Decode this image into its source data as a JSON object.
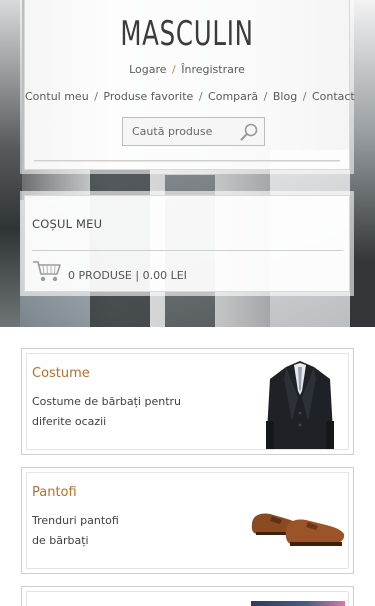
{
  "header": {
    "logo": "MASCULIN",
    "auth": {
      "login": "Logare",
      "separator": "/",
      "register": "Înregistrare"
    },
    "nav": [
      {
        "label": "Contul meu"
      },
      {
        "label": "Produse favorite"
      },
      {
        "label": "Compară"
      },
      {
        "label": "Blog"
      },
      {
        "label": "Contact"
      }
    ],
    "nav_separator": "/",
    "search": {
      "placeholder": "Caută produse",
      "icon": "search-icon"
    }
  },
  "cart": {
    "title": "COȘUL MEU",
    "summary": "0 PRODUSE | 0.00 LEI",
    "icon": "cart-icon"
  },
  "categories": [
    {
      "title": "Costume",
      "description": "Costume de bărbați pentru diferite ocazii",
      "image": "suit-image"
    },
    {
      "title": "Pantofi",
      "description": "Trenduri pantofi de bărbați",
      "image": "shoes-image"
    },
    {
      "title": "",
      "description": "",
      "image": "category-image"
    }
  ],
  "colors": {
    "accent": "#b2702c",
    "text": "#4a4a4a",
    "border": "#cfcfcf"
  }
}
